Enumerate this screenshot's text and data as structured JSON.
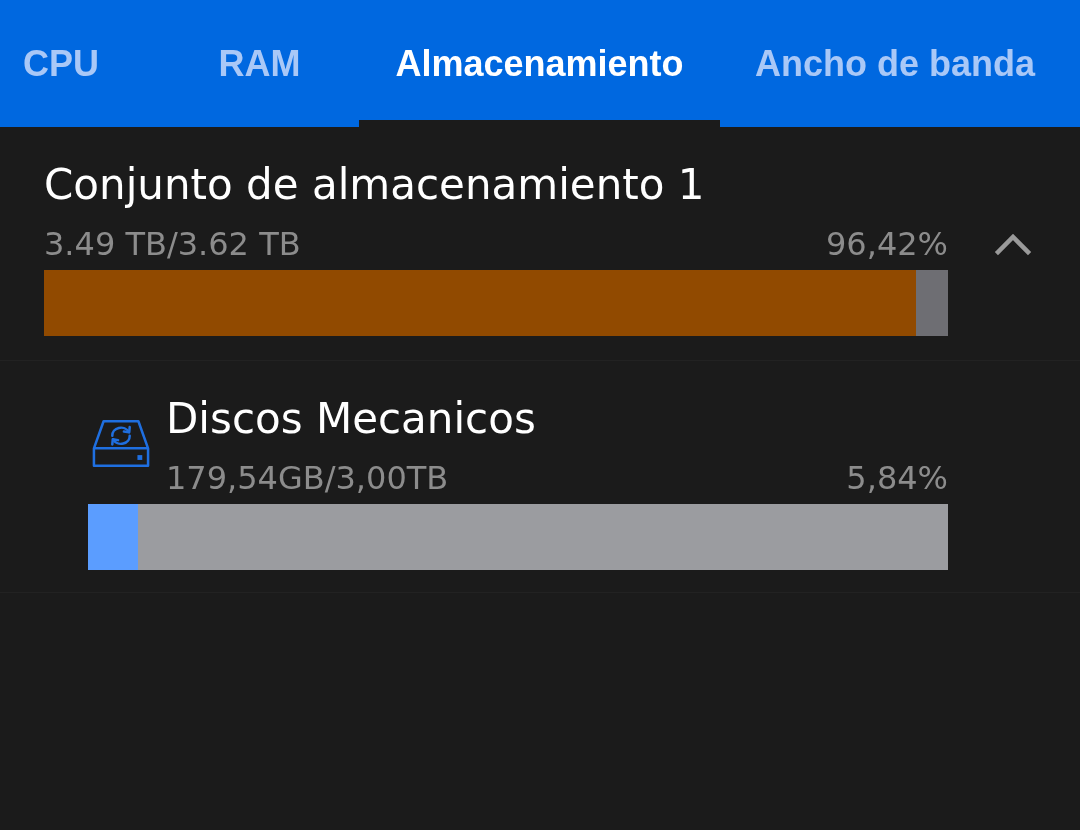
{
  "tabs": [
    {
      "label": "CPU",
      "selected": false
    },
    {
      "label": "RAM",
      "selected": false
    },
    {
      "label": "Almacenamiento",
      "selected": true
    },
    {
      "label": "Ancho de banda",
      "selected": false
    }
  ],
  "pools": [
    {
      "name": "Conjunto de almacenamiento 1",
      "usage": "3.49 TB/3.62 TB",
      "percent": "96,42%",
      "level": 0.9642,
      "color": "#914a00",
      "expanded": true,
      "children": [
        {
          "name": "Discos Mecanicos",
          "usage": "179,54GB/3,00TB",
          "percent": "5,84%",
          "level": 0.0584,
          "color": "#5b9dff"
        }
      ]
    }
  ]
}
